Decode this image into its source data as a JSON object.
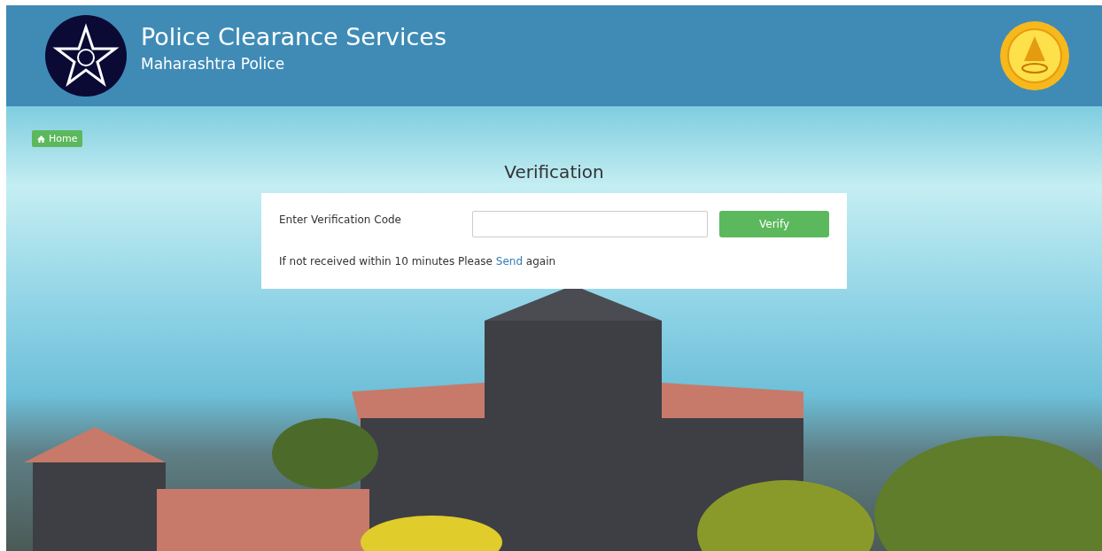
{
  "header": {
    "title": "Police Clearance Services",
    "subtitle": "Maharashtra Police"
  },
  "breadcrumb": {
    "label": "Home"
  },
  "page_title": "Verification",
  "form": {
    "label": "Enter Verification Code",
    "button": "Verify",
    "note": {
      "before": "If not received within 10 minutes Please",
      "link": "Send",
      "after": "again"
    }
  }
}
